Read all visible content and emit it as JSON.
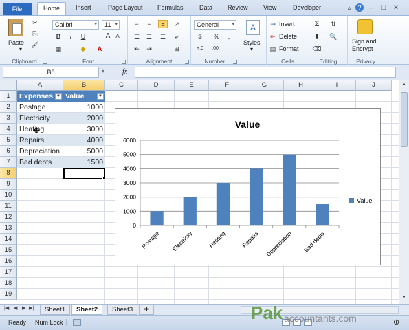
{
  "ribbon_tabs": {
    "file": "File",
    "home": "Home",
    "insert": "Insert",
    "page_layout": "Page Layout",
    "formulas": "Formulas",
    "data": "Data",
    "review": "Review",
    "view": "View",
    "developer": "Developer"
  },
  "clipboard": {
    "paste": "Paste",
    "label": "Clipboard"
  },
  "font": {
    "name": "Calibri",
    "size": "11",
    "bold": "B",
    "italic": "I",
    "underline": "U",
    "grow": "A",
    "shrink": "A",
    "label": "Font"
  },
  "alignment": {
    "label": "Alignment"
  },
  "number": {
    "format": "General",
    "currency": "$",
    "percent": "%",
    "comma": ",",
    "inc": "+.0",
    "dec": ".00",
    "label": "Number"
  },
  "styles": {
    "label": "Styles"
  },
  "cells": {
    "insert": "Insert",
    "delete": "Delete",
    "format": "Format",
    "label": "Cells"
  },
  "editing": {
    "sum": "Σ",
    "sort": "A",
    "label": "Editing"
  },
  "privacy": {
    "sign": "Sign and",
    "encrypt": "Encrypt",
    "label": "Privacy"
  },
  "formula_bar": {
    "name_box": "B8",
    "fx": "fx",
    "content": ""
  },
  "columns": [
    "A",
    "B",
    "C",
    "D",
    "E",
    "F",
    "G",
    "H",
    "I",
    "J"
  ],
  "rows": [
    "1",
    "2",
    "3",
    "4",
    "5",
    "6",
    "7",
    "8",
    "9",
    "10",
    "11",
    "12",
    "13",
    "14",
    "15",
    "16",
    "17",
    "18",
    "19"
  ],
  "table": {
    "headers": [
      "Expenses",
      "Value"
    ],
    "rows": [
      [
        "Postage",
        "1000"
      ],
      [
        "Electricity",
        "2000"
      ],
      [
        "Heating",
        "3000"
      ],
      [
        "Repairs",
        "4000"
      ],
      [
        "Depreciation",
        "5000"
      ],
      [
        "Bad debts",
        "1500"
      ]
    ]
  },
  "chart_data": {
    "type": "bar",
    "title": "Value",
    "categories": [
      "Postage",
      "Electricity",
      "Heating",
      "Repairs",
      "Depreciation",
      "Bad debts"
    ],
    "values": [
      1000,
      2000,
      3000,
      4000,
      5000,
      1500
    ],
    "series": [
      {
        "name": "Value",
        "values": [
          1000,
          2000,
          3000,
          4000,
          5000,
          1500
        ]
      }
    ],
    "yticks": [
      "0",
      "1000",
      "2000",
      "3000",
      "4000",
      "5000",
      "6000"
    ],
    "ylim": [
      0,
      6000
    ],
    "legend": "right",
    "grid": true,
    "color": "#4f81bd"
  },
  "sheets": [
    "Sheet1",
    "Sheet2",
    "Sheet3"
  ],
  "active_sheet": "Sheet2",
  "status": {
    "ready": "Ready",
    "num_lock": "Num Lock"
  },
  "watermark": {
    "pak": "Pak",
    "accountants": "accountants.com"
  }
}
